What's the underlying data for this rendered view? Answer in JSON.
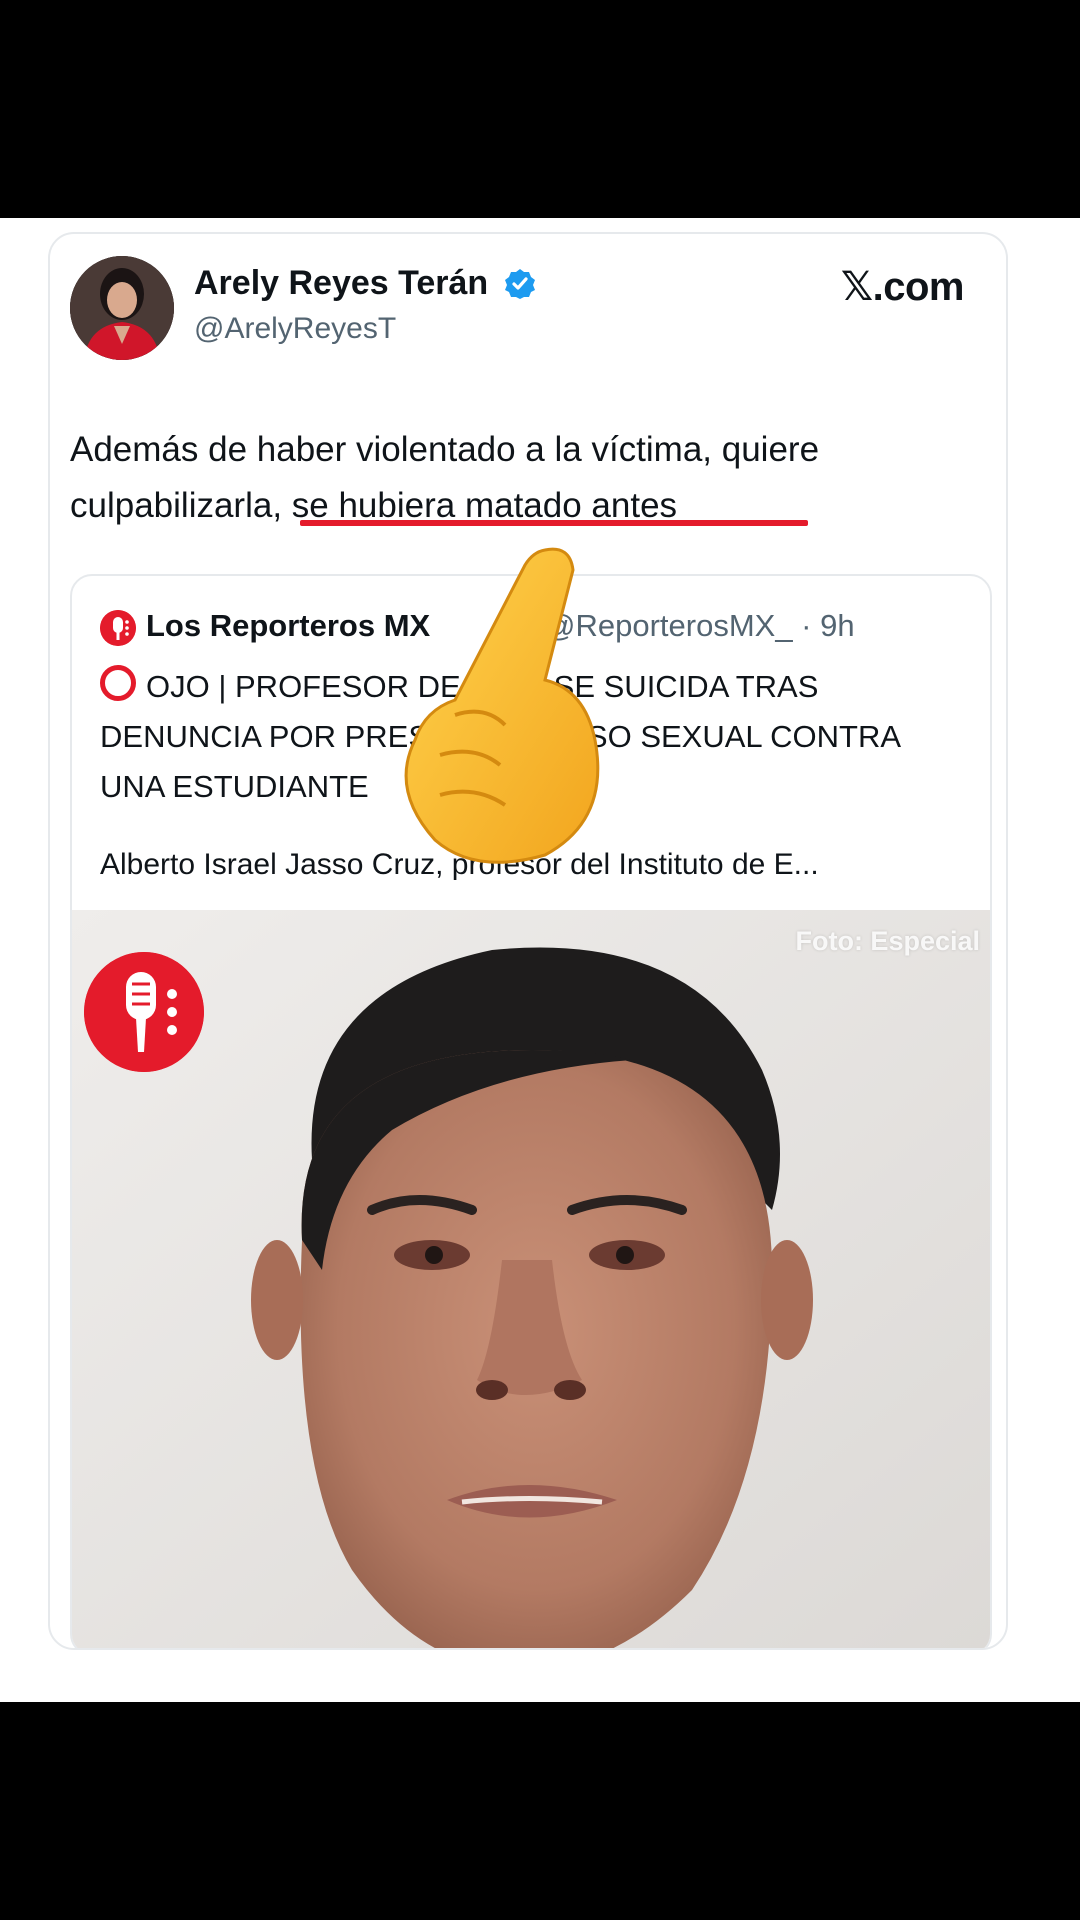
{
  "tweet": {
    "author_name": "Arely Reyes Terán",
    "author_handle": "@ArelyReyesT",
    "site_logo": "𝕏.com",
    "text_part1": "Además de haber violentado a la víctima, quiere culpabilizarla",
    "text_part2": ", se hubiera matado antes"
  },
  "quote": {
    "author_name": "Los Reporteros MX",
    "handle_time": "@ReporterosMX_ · 9h",
    "headline": "OJO | PROFESOR DE IEMS SE SUICIDA TRAS DENUNCIA POR PRESUNTO ABUSO SEXUAL CONTRA UNA ESTUDIANTE",
    "body": "Alberto Israel Jasso Cruz, profesor del Instituto de E...",
    "photo_credit": "Foto: Especial"
  },
  "icons": {
    "verified": "verified-badge-icon",
    "alert": "red-circle-icon",
    "brand": "microphone-logo-icon",
    "overlay": "pointing-hand-emoji"
  },
  "colors": {
    "accent_red": "#e41b2b",
    "verified_blue": "#1d9bf0",
    "text_primary": "#0f1419",
    "text_secondary": "#536471"
  }
}
